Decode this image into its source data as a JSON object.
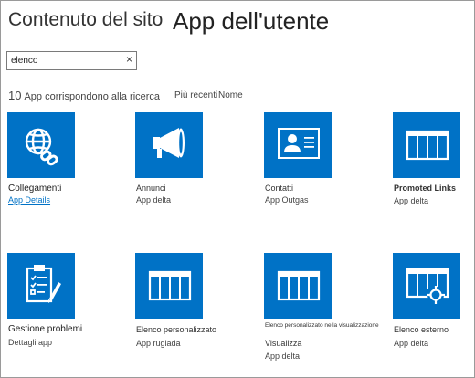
{
  "header": {
    "breadcrumb": "Contenuto del sito",
    "title": "App dell'utente"
  },
  "search": {
    "value": "elenco",
    "clear_glyph": "×"
  },
  "results": {
    "count": "10",
    "text": "App corrispondono alla ricerca",
    "sort_recent": "Più recenti",
    "sort_name": "Nome"
  },
  "apps": [
    {
      "name": "Collegamenti",
      "sub": "App Details",
      "icon": "globe-link-icon"
    },
    {
      "name": "Annunci",
      "sub": "App delta",
      "icon": "megaphone-icon"
    },
    {
      "name": "Contatti",
      "sub": "App Outgas",
      "icon": "contact-card-icon"
    },
    {
      "name": "Promoted Links",
      "sub": "App delta",
      "icon": "table-icon"
    },
    {
      "name": "Gestione problemi",
      "sub": "Dettagli app",
      "icon": "clipboard-checklist-icon"
    },
    {
      "name": "Elenco personalizzato",
      "sub": "App rugiada",
      "icon": "table-icon"
    },
    {
      "name": "Elenco personalizzato nella visualizzazione",
      "name2": "Visualizza",
      "sub": "App delta",
      "icon": "table-icon"
    },
    {
      "name": "Elenco esterno",
      "sub": "App delta",
      "icon": "external-list-icon"
    }
  ],
  "colors": {
    "tile": "#0072c6",
    "link": "#0072c6",
    "text": "#333333"
  }
}
